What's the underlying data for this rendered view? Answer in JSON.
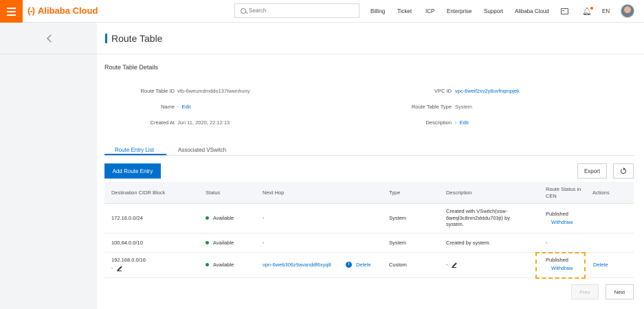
{
  "brand": {
    "logo_mark": "(-)",
    "name": "Alibaba Cloud",
    "accent": "#ff6a00",
    "link_color": "#0070cc"
  },
  "search": {
    "placeholder": "Search"
  },
  "topnav": {
    "items": [
      "Billing",
      "Ticket",
      "ICP",
      "Enterprise",
      "Support",
      "Alibaba Cloud"
    ],
    "language": "EN"
  },
  "page": {
    "title": "Route Table",
    "section_title": "Route Table Details"
  },
  "details": {
    "route_table_id_label": "Route Table ID",
    "route_table_id": "vtb-6weumdmddo137twwnhuny",
    "name_label": "Name",
    "name_value": "-",
    "name_edit": "Edit",
    "created_at_label": "Created At",
    "created_at": "Jun 11, 2020, 22:12:13",
    "vpc_id_label": "VPC ID",
    "vpc_id": "vpc-6weif2xv2y8uvfnqmpjek",
    "type_label": "Route Table Type",
    "type_value": "System",
    "description_label": "Description",
    "description_value": "-",
    "description_edit": "Edit"
  },
  "tabs": [
    "Route Entry List",
    "Associated VSwitch"
  ],
  "toolbar": {
    "add_label": "Add Route Entry",
    "export_label": "Export"
  },
  "table": {
    "headers": [
      "Destination CIDR Block",
      "Status",
      "Next Hop",
      "Type",
      "Description",
      "Route Status in CEN",
      "Actions"
    ],
    "rows": [
      {
        "cidr": "172.16.0.0/24",
        "status": "Available",
        "next_hop": "-",
        "type": "System",
        "description": "Created with VSwitch(vsw-6weql3c8nm2xktdu703jt) by system.",
        "cen_status": "Published",
        "cen_action": "Withdraw",
        "action": ""
      },
      {
        "cidr": "100.64.0.0/10",
        "status": "Available",
        "next_hop": "-",
        "type": "System",
        "description": "Created by system.",
        "cen_status": "-",
        "cen_action": "",
        "action": ""
      },
      {
        "cidr": "192.168.0.0/16",
        "cidr_sub": "-",
        "status": "Available",
        "next_hop": "vpn-6web306z9avanddf6xyq8",
        "next_hop_action": "Delete",
        "type": "Custom",
        "description": "-",
        "cen_status": "Published",
        "cen_action": "Withdraw",
        "action": "Delete"
      }
    ]
  },
  "pagination": {
    "prev_label": "Prev",
    "next_label": "Next"
  }
}
